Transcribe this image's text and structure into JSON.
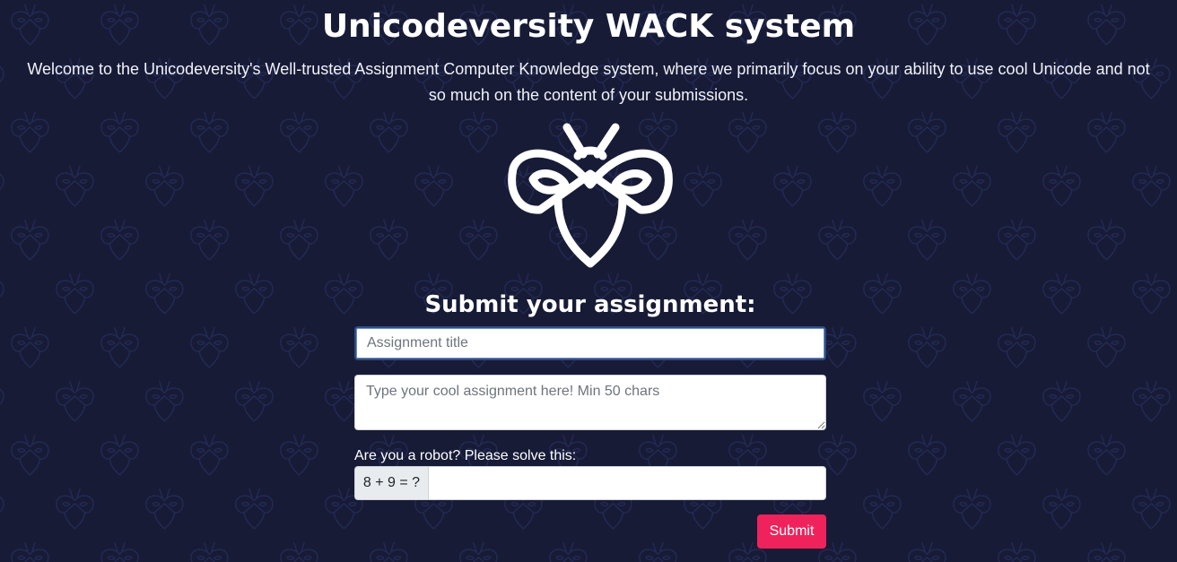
{
  "header": {
    "title": "Unicodeversity WACK system",
    "subtitle": "Welcome to the Unicodeversity's Well-trusted Assignment Computer Knowledge system, where we primarily focus on your ability to use cool Unicode and not so much on the content of your submissions."
  },
  "logo": {
    "icon": "owl-bee-logo-icon"
  },
  "form": {
    "heading": "Submit your assignment:",
    "title_placeholder": "Assignment title",
    "title_value": "",
    "assignment_placeholder": "Type your cool assignment here! Min 50 chars",
    "assignment_value": "",
    "captcha_label": "Are you a robot? Please solve this:",
    "captcha_question": "8 + 9 = ?",
    "captcha_value": "",
    "submit_label": "Submit"
  },
  "colors": {
    "background": "#171b36",
    "pattern": "#222a55",
    "accent": "#f0225c"
  }
}
